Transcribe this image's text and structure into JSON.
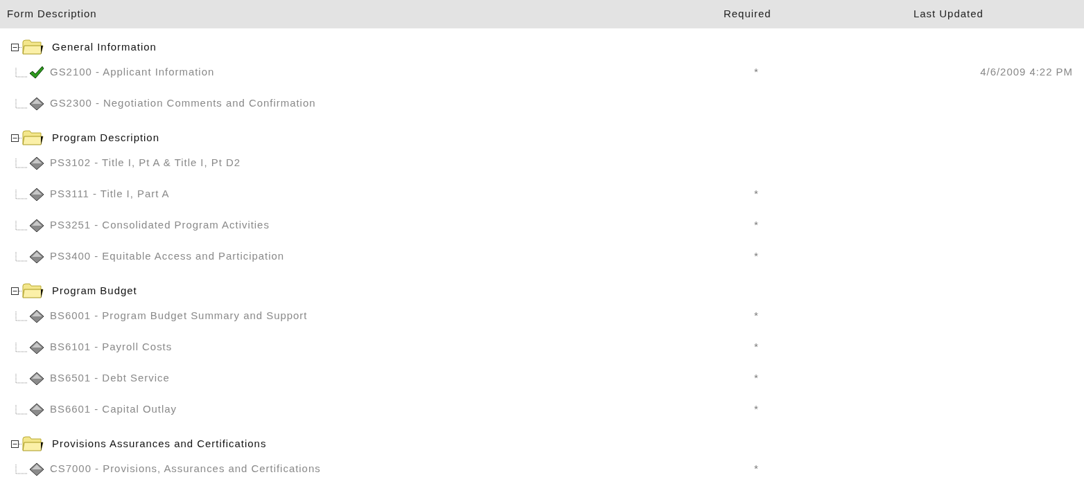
{
  "columns": [
    "Form Description",
    "Required",
    "Last Updated"
  ],
  "groups": [
    {
      "title": "General Information",
      "expanded": true,
      "forms": [
        {
          "name": "GS2100 - Applicant Information",
          "completed": true,
          "required": "*",
          "last_updated": "4/6/2009 4:22 PM"
        },
        {
          "name": "GS2300 - Negotiation Comments and Confirmation",
          "completed": false
        }
      ]
    },
    {
      "title": "Program Description",
      "expanded": true,
      "forms": [
        {
          "name": "PS3102 - Title I, Pt A & Title I, Pt D2",
          "completed": false
        },
        {
          "name": "PS3111 - Title I, Part A",
          "completed": false,
          "required": "*"
        },
        {
          "name": "PS3251 - Consolidated Program Activities",
          "completed": false,
          "required": "*"
        },
        {
          "name": "PS3400 - Equitable Access and Participation",
          "completed": false,
          "required": "*"
        }
      ]
    },
    {
      "title": "Program Budget",
      "expanded": true,
      "forms": [
        {
          "name": "BS6001 - Program Budget Summary and Support",
          "completed": false,
          "required": "*"
        },
        {
          "name": "BS6101 - Payroll Costs",
          "completed": false,
          "required": "*"
        },
        {
          "name": "BS6501 - Debt Service",
          "completed": false,
          "required": "*"
        },
        {
          "name": "BS6601 - Capital Outlay",
          "completed": false,
          "required": "*"
        }
      ]
    },
    {
      "title": "Provisions Assurances and Certifications",
      "expanded": true,
      "forms": [
        {
          "name": "CS7000 - Provisions, Assurances and Certifications",
          "completed": false,
          "required": "*"
        }
      ]
    }
  ]
}
